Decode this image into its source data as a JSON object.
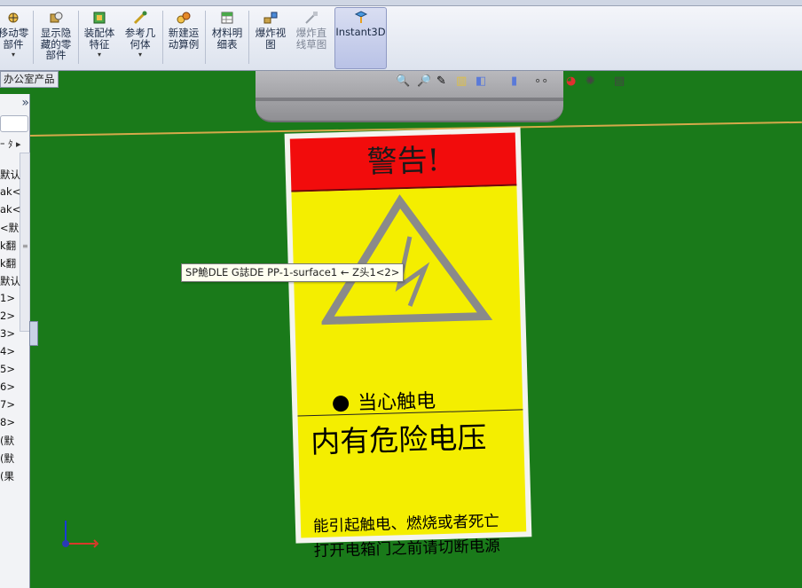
{
  "ribbon": {
    "buttons": [
      {
        "id": "move",
        "label": "移动零\n部件"
      },
      {
        "id": "show",
        "label": "显示隐\n藏的零\n部件"
      },
      {
        "id": "feature",
        "label": "装配体\n特征"
      },
      {
        "id": "refgeom",
        "label": "参考几\n何体"
      },
      {
        "id": "motion",
        "label": "新建运\n动算例"
      },
      {
        "id": "bom",
        "label": "材料明\n细表"
      },
      {
        "id": "explode",
        "label": "爆炸视\n图"
      },
      {
        "id": "exploderoute",
        "label": "爆炸直\n线草图"
      },
      {
        "id": "instant3d",
        "label": "Instant3D"
      }
    ]
  },
  "office_tab": "办公室产品",
  "left_panel": {
    "collapse": "»",
    "filter_glyph": "ｰ ﾀ ▸",
    "tree_items": [
      "默认",
      "ak<",
      "ak<",
      "<默",
      "k翻",
      "k翻",
      "默认",
      "1>",
      "2>",
      "3>",
      "4>",
      "5>",
      "6>",
      "7>",
      "8>",
      "(默",
      "(默",
      "(果"
    ]
  },
  "tooltip": "SP鮠DLE G誌DE PP-1-surface1 ← Z头1<2>",
  "sign": {
    "header": "警告!",
    "bullet_text": "当心触电",
    "main_text": "内有危险电压",
    "line1": "能引起触电、燃烧或者死亡",
    "line2": "打开电箱门之前请切断电源"
  },
  "colors": {
    "background": "#1a7a1a",
    "sign_red": "#f20c0c",
    "sign_yellow": "#f4ee00"
  }
}
